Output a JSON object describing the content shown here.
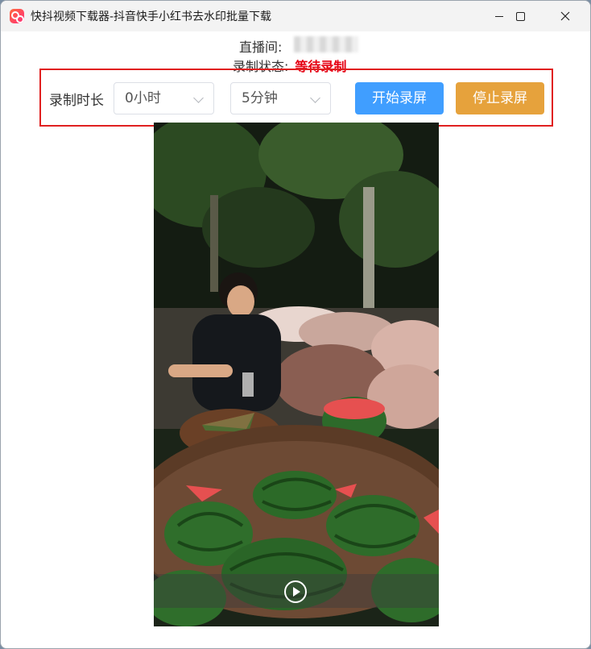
{
  "window": {
    "title": "快抖视频下载器-抖音快手小红书去水印批量下载",
    "icon": "app-logo-icon"
  },
  "info": {
    "room_label": "直播间:",
    "status_label": "录制状态:",
    "status_value": "等待录制"
  },
  "controls": {
    "duration_label": "录制时长",
    "hours_value": "0小时",
    "minutes_value": "5分钟",
    "start_button": "开始录屏",
    "stop_button": "停止录屏"
  },
  "colors": {
    "start": "#409eff",
    "stop": "#e6a23c",
    "status": "#e60012",
    "highlight": "#e02020"
  }
}
